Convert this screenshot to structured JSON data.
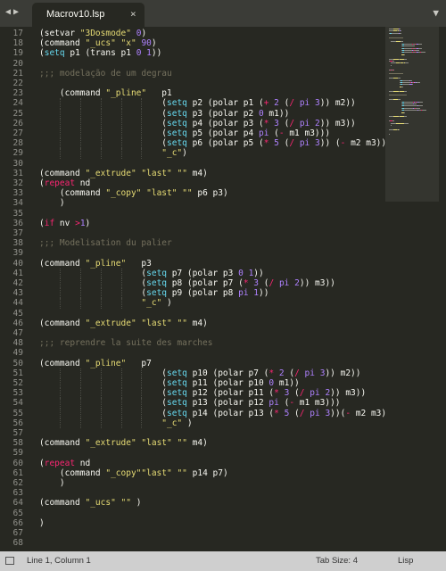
{
  "tab": {
    "title": "Macrov10.lsp",
    "close": "×"
  },
  "nav": {
    "back": "◀",
    "forward": "▶",
    "menu": "▼"
  },
  "editor": {
    "lines": [
      {
        "n": "17",
        "indent": 0,
        "tokens": [
          [
            "p",
            "(setvar "
          ],
          [
            "s",
            "\"3Dosmode\""
          ],
          [
            "p",
            " "
          ],
          [
            "n",
            "0"
          ],
          [
            "p",
            ")"
          ]
        ]
      },
      {
        "n": "18",
        "indent": 0,
        "tokens": [
          [
            "p",
            "(command "
          ],
          [
            "s",
            "\"_ucs\""
          ],
          [
            "p",
            " "
          ],
          [
            "s",
            "\"x\""
          ],
          [
            "p",
            " "
          ],
          [
            "n",
            "90"
          ],
          [
            "p",
            ")"
          ]
        ]
      },
      {
        "n": "19",
        "indent": 0,
        "tokens": [
          [
            "p",
            "("
          ],
          [
            "f",
            "setq"
          ],
          [
            "p",
            " p1 (trans p1 "
          ],
          [
            "n",
            "0"
          ],
          [
            "p",
            " "
          ],
          [
            "n",
            "1"
          ],
          [
            "p",
            "))"
          ]
        ]
      },
      {
        "n": "20",
        "indent": 0,
        "tokens": []
      },
      {
        "n": "21",
        "indent": 0,
        "tokens": [
          [
            "c",
            ";;; modelação de um degrau"
          ]
        ]
      },
      {
        "n": "22",
        "indent": 0,
        "tokens": []
      },
      {
        "n": "23",
        "indent": 4,
        "tokens": [
          [
            "p",
            "(command "
          ],
          [
            "s",
            "\"_pline\""
          ],
          [
            "p",
            "   p1"
          ]
        ]
      },
      {
        "n": "24",
        "indent": 24,
        "tokens": [
          [
            "p",
            "("
          ],
          [
            "f",
            "setq"
          ],
          [
            "p",
            " p2 (polar p1 ("
          ],
          [
            "k",
            "+"
          ],
          [
            "p",
            " "
          ],
          [
            "n",
            "2"
          ],
          [
            "p",
            " ("
          ],
          [
            "k",
            "/"
          ],
          [
            "p",
            " "
          ],
          [
            "n",
            "pi"
          ],
          [
            "p",
            " "
          ],
          [
            "n",
            "3"
          ],
          [
            "p",
            ")) m2))"
          ]
        ]
      },
      {
        "n": "25",
        "indent": 24,
        "tokens": [
          [
            "p",
            "("
          ],
          [
            "f",
            "setq"
          ],
          [
            "p",
            " p3 (polar p2 "
          ],
          [
            "n",
            "0"
          ],
          [
            "p",
            " m1))"
          ]
        ]
      },
      {
        "n": "26",
        "indent": 24,
        "tokens": [
          [
            "p",
            "("
          ],
          [
            "f",
            "setq"
          ],
          [
            "p",
            " p4 (polar p3 ("
          ],
          [
            "k",
            "*"
          ],
          [
            "p",
            " "
          ],
          [
            "n",
            "3"
          ],
          [
            "p",
            " ("
          ],
          [
            "k",
            "/"
          ],
          [
            "p",
            " "
          ],
          [
            "n",
            "pi"
          ],
          [
            "p",
            " "
          ],
          [
            "n",
            "2"
          ],
          [
            "p",
            ")) m3))"
          ]
        ]
      },
      {
        "n": "27",
        "indent": 24,
        "tokens": [
          [
            "p",
            "("
          ],
          [
            "f",
            "setq"
          ],
          [
            "p",
            " p5 (polar p4 "
          ],
          [
            "n",
            "pi"
          ],
          [
            "p",
            " ("
          ],
          [
            "k",
            "-"
          ],
          [
            "p",
            " m1 m3)))"
          ]
        ]
      },
      {
        "n": "28",
        "indent": 24,
        "tokens": [
          [
            "p",
            "("
          ],
          [
            "f",
            "setq"
          ],
          [
            "p",
            " p6 (polar p5 ("
          ],
          [
            "k",
            "*"
          ],
          [
            "p",
            " "
          ],
          [
            "n",
            "5"
          ],
          [
            "p",
            " ("
          ],
          [
            "k",
            "/"
          ],
          [
            "p",
            " "
          ],
          [
            "n",
            "pi"
          ],
          [
            "p",
            " "
          ],
          [
            "n",
            "3"
          ],
          [
            "p",
            ")) ("
          ],
          [
            "k",
            "-"
          ],
          [
            "p",
            " m2 m3)))"
          ]
        ]
      },
      {
        "n": "29",
        "indent": 24,
        "tokens": [
          [
            "s",
            "\"_c\""
          ],
          [
            "p",
            ")"
          ]
        ]
      },
      {
        "n": "30",
        "indent": 0,
        "tokens": []
      },
      {
        "n": "31",
        "indent": 0,
        "tokens": [
          [
            "p",
            "(command "
          ],
          [
            "s",
            "\"_extrude\""
          ],
          [
            "p",
            " "
          ],
          [
            "s",
            "\"last\""
          ],
          [
            "p",
            " "
          ],
          [
            "s",
            "\"\""
          ],
          [
            "p",
            " m4)"
          ]
        ]
      },
      {
        "n": "32",
        "indent": 0,
        "tokens": [
          [
            "p",
            "("
          ],
          [
            "k",
            "repeat"
          ],
          [
            "p",
            " nd"
          ]
        ]
      },
      {
        "n": "33",
        "indent": 4,
        "tokens": [
          [
            "p",
            "(command "
          ],
          [
            "s",
            "\"_copy\""
          ],
          [
            "p",
            " "
          ],
          [
            "s",
            "\"last\""
          ],
          [
            "p",
            " "
          ],
          [
            "s",
            "\"\""
          ],
          [
            "p",
            " p6 p3)"
          ]
        ]
      },
      {
        "n": "34",
        "indent": 4,
        "tokens": [
          [
            "p",
            ")"
          ]
        ]
      },
      {
        "n": "35",
        "indent": 0,
        "tokens": []
      },
      {
        "n": "36",
        "indent": 0,
        "tokens": [
          [
            "p",
            "("
          ],
          [
            "k",
            "if"
          ],
          [
            "p",
            " nv "
          ],
          [
            "k",
            ">"
          ],
          [
            "n",
            "1"
          ],
          [
            "p",
            ")"
          ]
        ]
      },
      {
        "n": "37",
        "indent": 0,
        "tokens": []
      },
      {
        "n": "38",
        "indent": 0,
        "tokens": [
          [
            "c",
            ";;; Modelisation du palier"
          ]
        ]
      },
      {
        "n": "39",
        "indent": 0,
        "tokens": []
      },
      {
        "n": "40",
        "indent": 0,
        "tokens": [
          [
            "p",
            "(command "
          ],
          [
            "s",
            "\"_pline\""
          ],
          [
            "p",
            "   p3"
          ]
        ]
      },
      {
        "n": "41",
        "indent": 20,
        "tokens": [
          [
            "p",
            "("
          ],
          [
            "f",
            "setq"
          ],
          [
            "p",
            " p7 (polar p3 "
          ],
          [
            "n",
            "0"
          ],
          [
            "p",
            " "
          ],
          [
            "n",
            "1"
          ],
          [
            "p",
            "))"
          ]
        ]
      },
      {
        "n": "42",
        "indent": 20,
        "tokens": [
          [
            "p",
            "("
          ],
          [
            "f",
            "setq"
          ],
          [
            "p",
            " p8 (polar p7 ("
          ],
          [
            "k",
            "*"
          ],
          [
            "p",
            " "
          ],
          [
            "n",
            "3"
          ],
          [
            "p",
            " ("
          ],
          [
            "k",
            "/"
          ],
          [
            "p",
            " "
          ],
          [
            "n",
            "pi"
          ],
          [
            "p",
            " "
          ],
          [
            "n",
            "2"
          ],
          [
            "p",
            ")) m3))"
          ]
        ]
      },
      {
        "n": "43",
        "indent": 20,
        "tokens": [
          [
            "p",
            "("
          ],
          [
            "f",
            "setq"
          ],
          [
            "p",
            " p9 (polar p8 "
          ],
          [
            "n",
            "pi"
          ],
          [
            "p",
            " "
          ],
          [
            "n",
            "1"
          ],
          [
            "p",
            "))"
          ]
        ]
      },
      {
        "n": "44",
        "indent": 20,
        "tokens": [
          [
            "s",
            "\"_c\""
          ],
          [
            "p",
            " )"
          ]
        ]
      },
      {
        "n": "45",
        "indent": 0,
        "tokens": []
      },
      {
        "n": "46",
        "indent": 0,
        "tokens": [
          [
            "p",
            "(command "
          ],
          [
            "s",
            "\"_extrude\""
          ],
          [
            "p",
            " "
          ],
          [
            "s",
            "\"last\""
          ],
          [
            "p",
            " "
          ],
          [
            "s",
            "\"\""
          ],
          [
            "p",
            " m4)"
          ]
        ]
      },
      {
        "n": "47",
        "indent": 0,
        "tokens": []
      },
      {
        "n": "48",
        "indent": 0,
        "tokens": [
          [
            "c",
            ";;; reprendre la suite des marches"
          ]
        ]
      },
      {
        "n": "49",
        "indent": 0,
        "tokens": []
      },
      {
        "n": "50",
        "indent": 0,
        "tokens": [
          [
            "p",
            "(command "
          ],
          [
            "s",
            "\"_pline\""
          ],
          [
            "p",
            "   p7"
          ]
        ]
      },
      {
        "n": "51",
        "indent": 24,
        "tokens": [
          [
            "p",
            "("
          ],
          [
            "f",
            "setq"
          ],
          [
            "p",
            " p10 (polar p7 ("
          ],
          [
            "k",
            "*"
          ],
          [
            "p",
            " "
          ],
          [
            "n",
            "2"
          ],
          [
            "p",
            " ("
          ],
          [
            "k",
            "/"
          ],
          [
            "p",
            " "
          ],
          [
            "n",
            "pi"
          ],
          [
            "p",
            " "
          ],
          [
            "n",
            "3"
          ],
          [
            "p",
            ")) m2))"
          ]
        ]
      },
      {
        "n": "52",
        "indent": 24,
        "tokens": [
          [
            "p",
            "("
          ],
          [
            "f",
            "setq"
          ],
          [
            "p",
            " p11 (polar p10 "
          ],
          [
            "n",
            "0"
          ],
          [
            "p",
            " m1))"
          ]
        ]
      },
      {
        "n": "53",
        "indent": 24,
        "tokens": [
          [
            "p",
            "("
          ],
          [
            "f",
            "setq"
          ],
          [
            "p",
            " p12 (polar p11 ("
          ],
          [
            "k",
            "*"
          ],
          [
            "p",
            " "
          ],
          [
            "n",
            "3"
          ],
          [
            "p",
            " ("
          ],
          [
            "k",
            "/"
          ],
          [
            "p",
            " "
          ],
          [
            "n",
            "pi"
          ],
          [
            "p",
            " "
          ],
          [
            "n",
            "2"
          ],
          [
            "p",
            ")) m3))"
          ]
        ]
      },
      {
        "n": "54",
        "indent": 24,
        "tokens": [
          [
            "p",
            "("
          ],
          [
            "f",
            "setq"
          ],
          [
            "p",
            " p13 (polar p12 "
          ],
          [
            "n",
            "pi"
          ],
          [
            "p",
            " ("
          ],
          [
            "k",
            "-"
          ],
          [
            "p",
            " m1 m3)))"
          ]
        ]
      },
      {
        "n": "55",
        "indent": 24,
        "tokens": [
          [
            "p",
            "("
          ],
          [
            "f",
            "setq"
          ],
          [
            "p",
            " p14 (polar p13 ("
          ],
          [
            "k",
            "*"
          ],
          [
            "p",
            " "
          ],
          [
            "n",
            "5"
          ],
          [
            "p",
            " ("
          ],
          [
            "k",
            "/"
          ],
          [
            "p",
            " "
          ],
          [
            "n",
            "pi"
          ],
          [
            "p",
            " "
          ],
          [
            "n",
            "3"
          ],
          [
            "p",
            "))("
          ],
          [
            "k",
            "-"
          ],
          [
            "p",
            " m2 m3)))"
          ]
        ]
      },
      {
        "n": "56",
        "indent": 24,
        "tokens": [
          [
            "s",
            "\"_c\""
          ],
          [
            "p",
            " )"
          ]
        ]
      },
      {
        "n": "57",
        "indent": 0,
        "tokens": []
      },
      {
        "n": "58",
        "indent": 0,
        "tokens": [
          [
            "p",
            "(command "
          ],
          [
            "s",
            "\"_extrude\""
          ],
          [
            "p",
            " "
          ],
          [
            "s",
            "\"last\""
          ],
          [
            "p",
            " "
          ],
          [
            "s",
            "\"\""
          ],
          [
            "p",
            " m4)"
          ]
        ]
      },
      {
        "n": "59",
        "indent": 0,
        "tokens": []
      },
      {
        "n": "60",
        "indent": 0,
        "tokens": [
          [
            "p",
            "("
          ],
          [
            "k",
            "repeat"
          ],
          [
            "p",
            " nd"
          ]
        ]
      },
      {
        "n": "61",
        "indent": 4,
        "tokens": [
          [
            "p",
            "(command "
          ],
          [
            "s",
            "\"_copy\"\"last\""
          ],
          [
            "p",
            " "
          ],
          [
            "s",
            "\"\""
          ],
          [
            "p",
            " p14 p7)"
          ]
        ]
      },
      {
        "n": "62",
        "indent": 4,
        "tokens": [
          [
            "p",
            ")"
          ]
        ]
      },
      {
        "n": "63",
        "indent": 0,
        "tokens": []
      },
      {
        "n": "64",
        "indent": 0,
        "tokens": [
          [
            "p",
            "(command "
          ],
          [
            "s",
            "\"_ucs\""
          ],
          [
            "p",
            " "
          ],
          [
            "s",
            "\"\""
          ],
          [
            "p",
            " )"
          ]
        ]
      },
      {
        "n": "65",
        "indent": 0,
        "tokens": []
      },
      {
        "n": "66",
        "indent": 0,
        "tokens": [
          [
            "p",
            ")"
          ]
        ]
      },
      {
        "n": "67",
        "indent": 0,
        "tokens": []
      },
      {
        "n": "68",
        "indent": 0,
        "tokens": []
      }
    ]
  },
  "statusbar": {
    "position": "Line 1, Column 1",
    "tab_size": "Tab Size: 4",
    "syntax": "Lisp"
  },
  "colors": {
    "background": "#272822",
    "function": "#66d9ef",
    "keyword": "#f92672",
    "string": "#e6db74",
    "number": "#ae81ff",
    "comment": "#75715e",
    "text": "#f8f8f2"
  }
}
